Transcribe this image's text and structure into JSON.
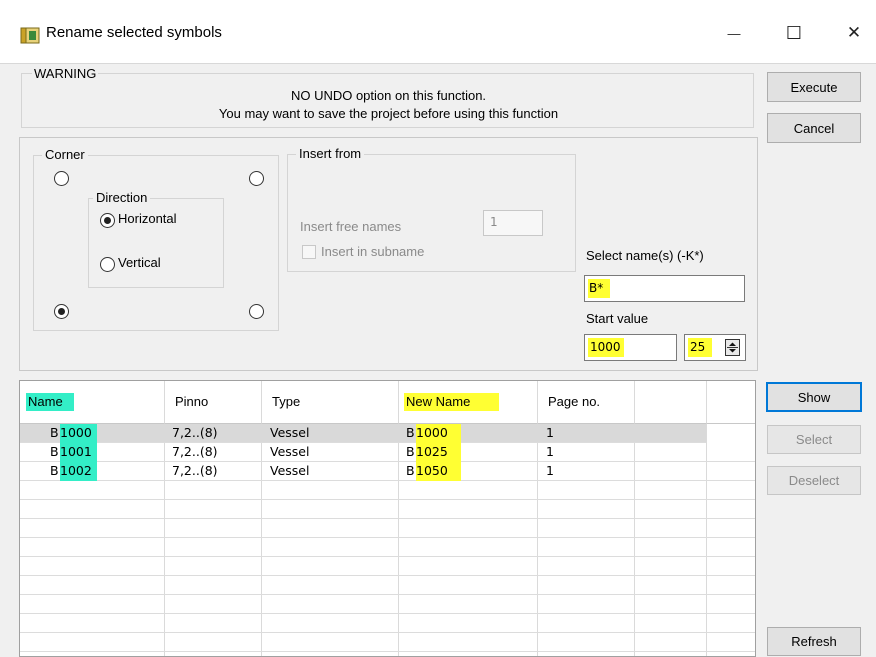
{
  "window": {
    "title": "Rename selected symbols",
    "icon": "folder-app-icon",
    "controls": {
      "minimize": "—",
      "maximize": "☐",
      "close": "✕"
    }
  },
  "warning": {
    "title": "WARNING",
    "line1": "NO UNDO option on this function.",
    "line2": "You may want to save the project before using this function"
  },
  "buttons": {
    "execute": "Execute",
    "cancel": "Cancel",
    "show": "Show",
    "select": "Select",
    "deselect": "Deselect",
    "refresh": "Refresh"
  },
  "corner": {
    "title": "Corner",
    "selected": "bottom-left",
    "direction": {
      "title": "Direction",
      "horizontal": "Horizontal",
      "vertical": "Vertical",
      "selected": "Horizontal"
    }
  },
  "insert_from": {
    "title": "Insert from",
    "free_names_label": "Insert free names",
    "free_names_value": "1",
    "subname_label": "Insert in subname",
    "subname_checked": false
  },
  "select_names": {
    "label": "Select name(s) (-K*)",
    "value": "B*"
  },
  "start_value": {
    "label": "Start value",
    "value": "1000",
    "step": "25"
  },
  "table": {
    "columns": [
      "Name",
      "Pinno",
      "Type",
      "New Name",
      "Page no."
    ],
    "rows": [
      {
        "name_prefix": "B",
        "name_num": "1000",
        "pinno": "7,2..(8)",
        "type": "Vessel",
        "new_prefix": "B",
        "new_num": "1000",
        "page": "1"
      },
      {
        "name_prefix": "B",
        "name_num": "1001",
        "pinno": "7,2..(8)",
        "type": "Vessel",
        "new_prefix": "B",
        "new_num": "1025",
        "page": "1"
      },
      {
        "name_prefix": "B",
        "name_num": "1002",
        "pinno": "7,2..(8)",
        "type": "Vessel",
        "new_prefix": "B",
        "new_num": "1050",
        "page": "1"
      }
    ]
  },
  "colors": {
    "highlight_yellow": "#ffff33",
    "highlight_cyan": "#33eec7",
    "focus_blue": "#0078d7"
  }
}
